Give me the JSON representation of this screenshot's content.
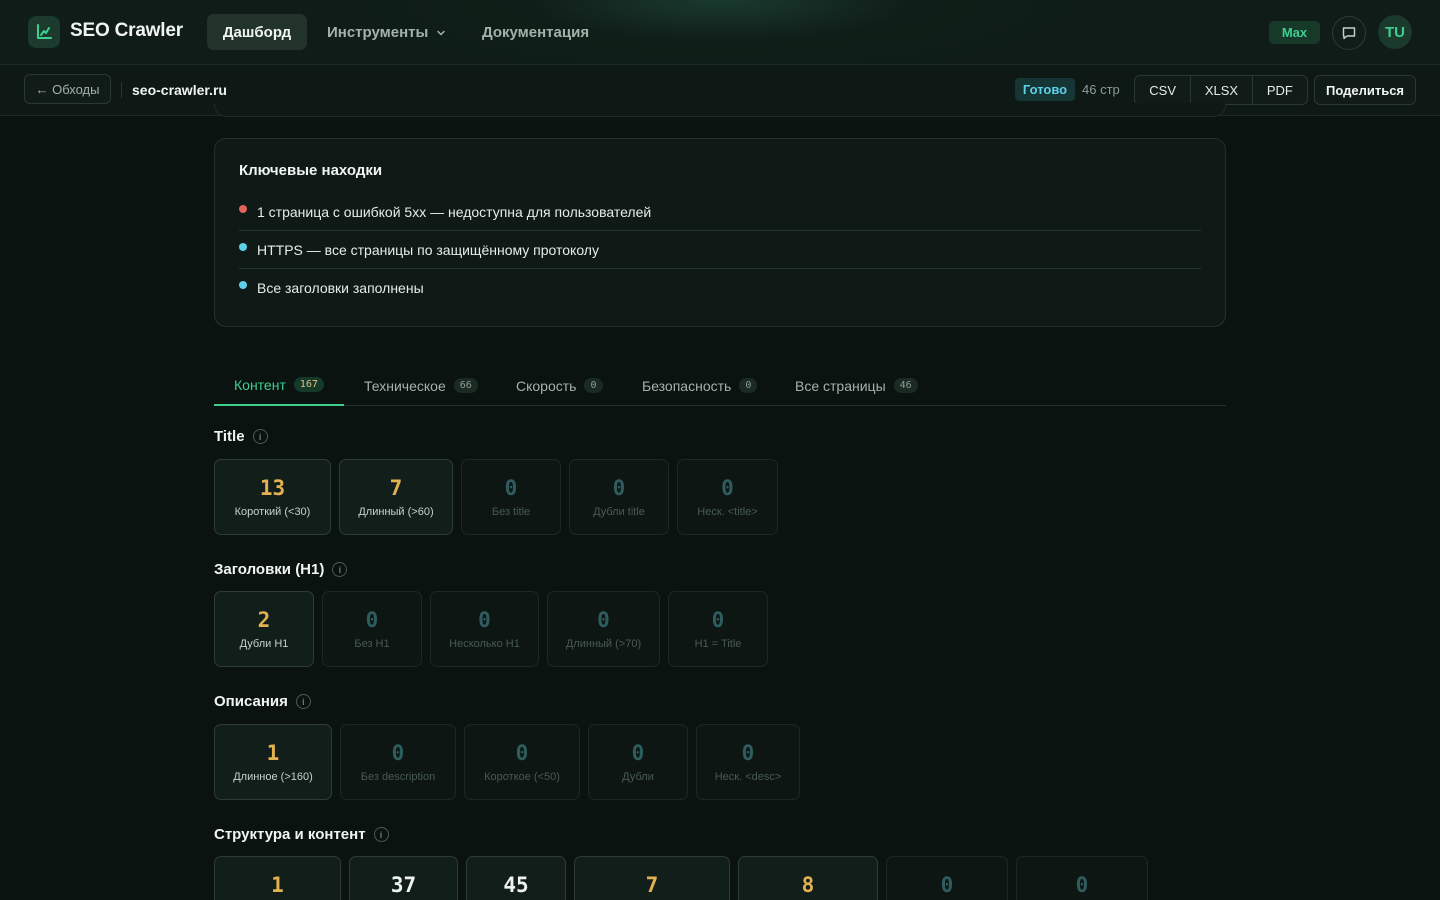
{
  "app": {
    "name": "SEO Crawler",
    "nav": {
      "dashboard": "Дашборд",
      "tools": "Инструменты",
      "docs": "Документация"
    },
    "plan": "Max",
    "avatar_initials": "TU"
  },
  "subbar": {
    "back_label": "← Обходы",
    "domain": "seo-crawler.ru",
    "status": "Готово",
    "pages": "46 стр",
    "exports": [
      "CSV",
      "XLSX",
      "PDF"
    ],
    "share_label": "Поделиться"
  },
  "findings": {
    "title": "Ключевые находки",
    "items": [
      {
        "text": "1 страница с ошибкой 5xx — недоступна для пользователей",
        "color": "#e0645a"
      },
      {
        "text": "HTTPS — все страницы по защищённому протоколу",
        "color": "#5fd0ea"
      },
      {
        "text": "Все заголовки заполнены",
        "color": "#5fd0ea"
      }
    ]
  },
  "tabs": [
    {
      "label": "Контент",
      "count": "167"
    },
    {
      "label": "Техническое",
      "count": "66"
    },
    {
      "label": "Скорость",
      "count": "0"
    },
    {
      "label": "Безопасность",
      "count": "0"
    },
    {
      "label": "Все страницы",
      "count": "46"
    }
  ],
  "sections": {
    "title_section": {
      "title": "Title",
      "metrics": [
        {
          "value": "13",
          "label": "Короткий (<30)"
        },
        {
          "value": "7",
          "label": "Длинный (>60)"
        },
        {
          "value": "0",
          "label": "Без title"
        },
        {
          "value": "0",
          "label": "Дубли title"
        },
        {
          "value": "0",
          "label": "Неск. <title>"
        }
      ]
    },
    "h1_section": {
      "title": "Заголовки (H1)",
      "metrics": [
        {
          "value": "2",
          "label": "Дубли H1"
        },
        {
          "value": "0",
          "label": "Без H1"
        },
        {
          "value": "0",
          "label": "Несколько H1"
        },
        {
          "value": "0",
          "label": "Длинный (>70)"
        },
        {
          "value": "0",
          "label": "H1 = Title"
        }
      ]
    },
    "desc_section": {
      "title": "Описания",
      "metrics": [
        {
          "value": "1",
          "label": "Длинное (>160)"
        },
        {
          "value": "0",
          "label": "Без description"
        },
        {
          "value": "0",
          "label": "Короткое (<50)"
        },
        {
          "value": "0",
          "label": "Дубли"
        },
        {
          "value": "0",
          "label": "Неск. <desc>"
        }
      ]
    },
    "structure_section": {
      "title": "Структура и контент",
      "metrics": [
        {
          "value": "1"
        },
        {
          "value": "37"
        },
        {
          "value": "45"
        },
        {
          "value": "7"
        },
        {
          "value": "8"
        },
        {
          "value": "0"
        },
        {
          "value": "0"
        }
      ]
    }
  },
  "colors": {
    "accent": "#3ecf8e",
    "warning": "#e3b150",
    "error": "#e0645a",
    "info": "#5fd0ea"
  }
}
